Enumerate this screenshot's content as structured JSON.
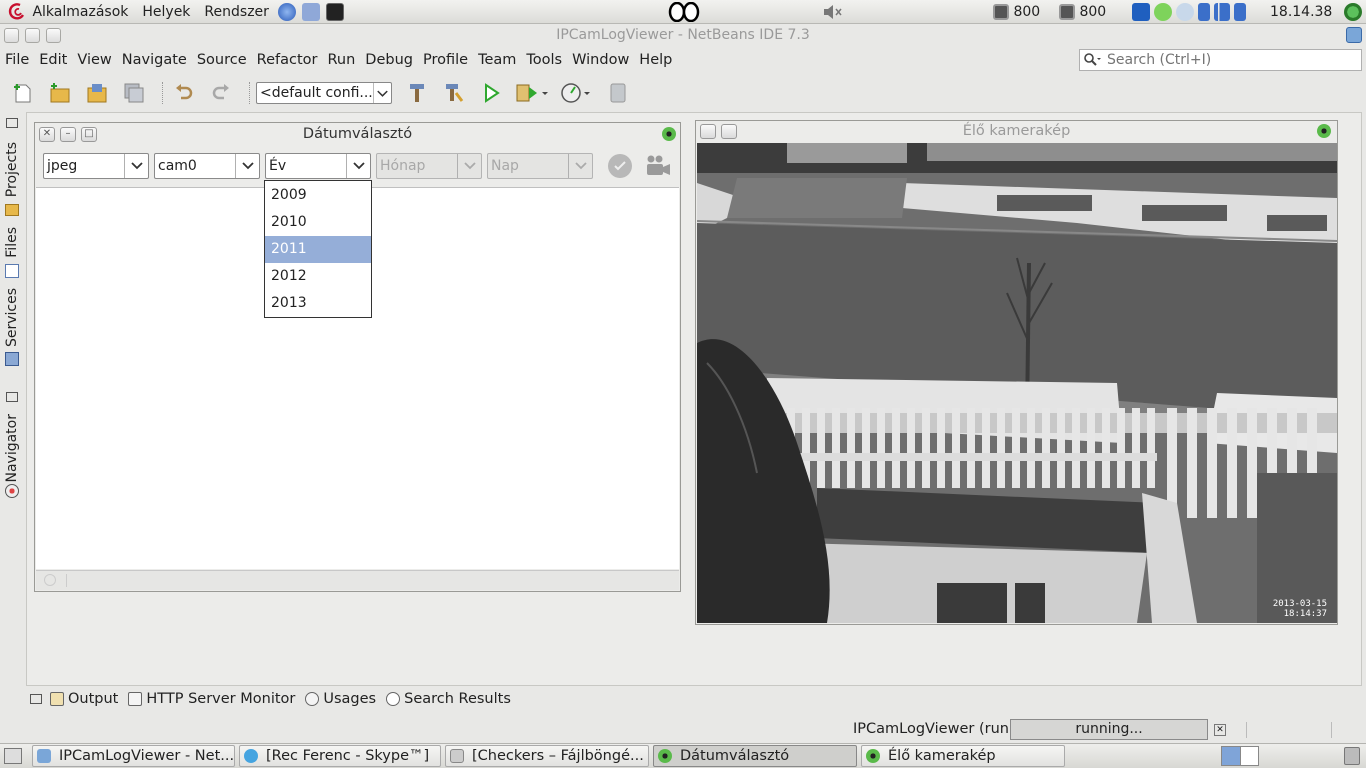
{
  "gnome_panel": {
    "menus": [
      "Alkalmazások",
      "Helyek",
      "Rendszer"
    ],
    "cpu1": "800",
    "cpu2": "800",
    "clock": "18.14.38"
  },
  "window": {
    "title": "IPCamLogViewer - NetBeans IDE 7.3"
  },
  "menubar": [
    "File",
    "Edit",
    "View",
    "Navigate",
    "Source",
    "Refactor",
    "Run",
    "Debug",
    "Profile",
    "Team",
    "Tools",
    "Window",
    "Help"
  ],
  "search": {
    "placeholder": "Search (Ctrl+I)"
  },
  "toolbar": {
    "config_value": "<default confi..."
  },
  "side_tabs": [
    "Projects",
    "Files",
    "Services",
    "Navigator"
  ],
  "date_window": {
    "title": "Dátumválasztó",
    "format_combo": "jpeg",
    "camera_combo": "cam0",
    "year_combo": "Év",
    "month_combo": "Hónap",
    "day_combo": "Nap",
    "year_options": [
      "2009",
      "2010",
      "2011",
      "2012",
      "2013"
    ],
    "selected_year": "2011"
  },
  "camera_window": {
    "title": "Élő kamerakép",
    "timestamp_date": "2013-03-15",
    "timestamp_time": "18:14:37"
  },
  "output_tabs": [
    "Output",
    "HTTP Server Monitor",
    "Usages",
    "Search Results"
  ],
  "status": {
    "run_label": "IPCamLogViewer (run)",
    "progress_text": "running..."
  },
  "taskbar": [
    "IPCamLogViewer - Net...",
    "[Rec Ferenc - Skype™]",
    "[Checkers – Fájlböngé...",
    "Dátumválasztó",
    "Élő kamerakép"
  ],
  "colors": {
    "selection": "#95aed8",
    "run_green": "#2fa82f",
    "cam_icon_green": "#3c9a3c"
  }
}
